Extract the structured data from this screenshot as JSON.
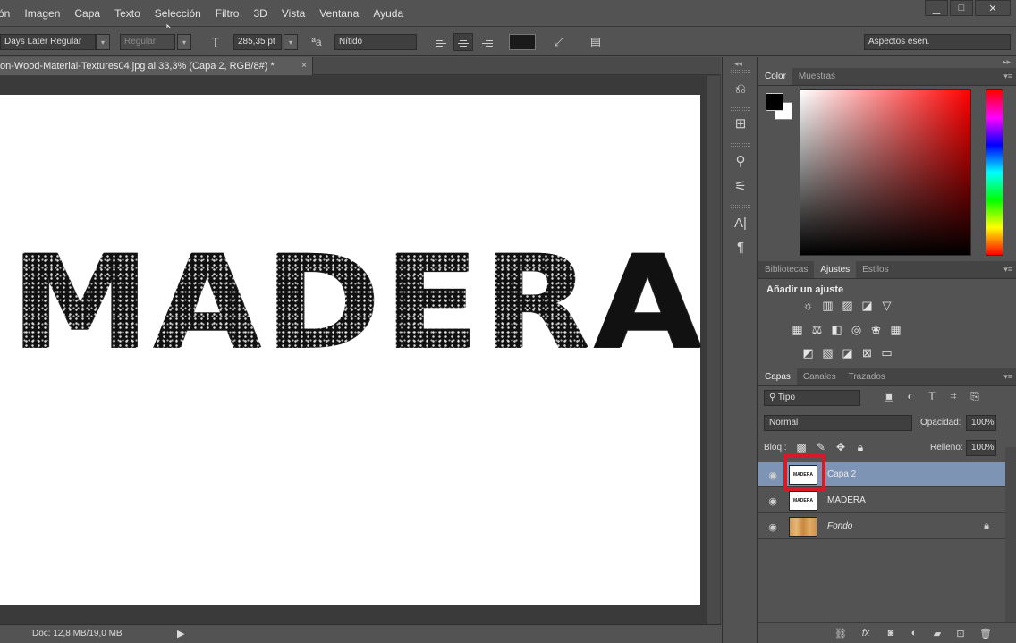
{
  "menu": {
    "items": [
      "ón",
      "Imagen",
      "Capa",
      "Texto",
      "Selección",
      "Filtro",
      "3D",
      "Vista",
      "Ventana",
      "Ayuda"
    ]
  },
  "window_controls": {
    "minimize": "▁",
    "maximize": "□",
    "close": "✕"
  },
  "options": {
    "font_family": "Days Later Regular",
    "font_style": "Regular",
    "font_size": "285,35 pt",
    "aa_label": "ªa",
    "antialias": "Nítido",
    "text_color": "#1a1a1a",
    "workspace": "Aspectos esen."
  },
  "document": {
    "tab_title": "on-Wood-Material-Textures04.jpg al 33,3% (Capa 2, RGB/8#) *",
    "tab_close": "×",
    "canvas_text": "MADERA"
  },
  "status": {
    "doc_info": "Doc: 12,8 MB/19,0 MB",
    "arrow": "▶"
  },
  "color_panel": {
    "tabs": [
      "Color",
      "Muestras"
    ],
    "foreground": "#000000",
    "background": "#ffffff"
  },
  "adjust_panel": {
    "tabs": [
      "Bibliotecas",
      "Ajustes",
      "Estilos"
    ],
    "title": "Añadir un ajuste"
  },
  "layers_panel": {
    "tabs": [
      "Capas",
      "Canales",
      "Trazados"
    ],
    "filter": "Tipo",
    "blend_mode": "Normal",
    "opacity_label": "Opacidad:",
    "opacity_value": "100%",
    "lock_label": "Bloq.:",
    "fill_label": "Relleno:",
    "fill_value": "100%",
    "layers": [
      {
        "name": "Capa 2",
        "thumb": "MADERA",
        "selected": true
      },
      {
        "name": "MADERA",
        "thumb": "MADERA",
        "selected": false
      },
      {
        "name": "Fondo",
        "thumb": "",
        "selected": false
      }
    ]
  },
  "colors": {
    "highlight": "#d61b27",
    "selected_row": "#7d94b5"
  }
}
